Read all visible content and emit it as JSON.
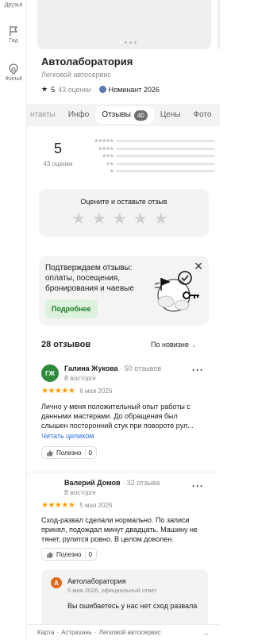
{
  "rail": {
    "items": [
      {
        "label": "Друзья",
        "icon": "friends-icon"
      },
      {
        "label": "Гид",
        "icon": "flag-icon"
      },
      {
        "label": "Жильё",
        "icon": "home-icon"
      }
    ]
  },
  "org": {
    "title": "Автолаборатория",
    "subtitle": "Легковой автосервис",
    "rating": "5",
    "ratings_count": "43 оценки",
    "nominee": "Номинант 2026"
  },
  "tabs": {
    "contacts": "нтакты",
    "info": "Инфо",
    "reviews": "Отзывы",
    "reviews_badge": "40",
    "prices": "Цены",
    "photo": "Фото"
  },
  "summary": {
    "rating": "5",
    "count": "43 оценки",
    "bars": [
      "★★★★★",
      "★★★★",
      "★★★",
      "★★",
      "★"
    ]
  },
  "rate": {
    "prompt": "Оцените и оставьте отзыв"
  },
  "promo": {
    "text": "Подтверждаем отзывы: оплаты, посещения, бронирования и чаевые",
    "button": "Подробнее"
  },
  "reviews_header": {
    "count": "28 отзывов",
    "sort": "По новизне"
  },
  "reviews": [
    {
      "initials": "ГЖ",
      "avatar_color": "#2e8b3c",
      "name": "Галина Жукова",
      "reviews_count": "· 50 отзывов",
      "status": "В восторге",
      "stars": "★★★★★",
      "date": "6 мая 2026",
      "text": "Лично у меня положительный опыт работы с данными мастерами. До обращения был слышен посторонний стук при повороте рул...",
      "read_more": "Читать целиком",
      "useful_label": "Полезно",
      "useful_count": "0"
    },
    {
      "initials": "",
      "avatar_color": "#ffffff",
      "name": "Валерий Домов",
      "reviews_count": "· 32 отзыва",
      "status": "В восторге",
      "stars": "★★★★★",
      "date": "5 мая 2026",
      "text": "Сход-развал сделали нормально. По записи принял, подождал минут двадцать. Машину не тянет, рулится ровно. В целом доволен.",
      "useful_label": "Полезно",
      "useful_count": "0"
    }
  ],
  "reply": {
    "initial": "А",
    "name": "Автолаборатория",
    "date": "5 мая 2026, официальный ответ",
    "text": "Вы ошибаетесь у нас нет сход развала"
  },
  "footer": {
    "crumb1": "Карта",
    "crumb2": "Астрахань",
    "crumb3": "Легковой автосервис",
    "sep": "·",
    "more": "..."
  },
  "colors": {
    "star_active": "#fc9d00",
    "link": "#2a6fd9",
    "promo_button_bg": "#dcf2dc",
    "promo_button_text": "#1d7a26"
  }
}
